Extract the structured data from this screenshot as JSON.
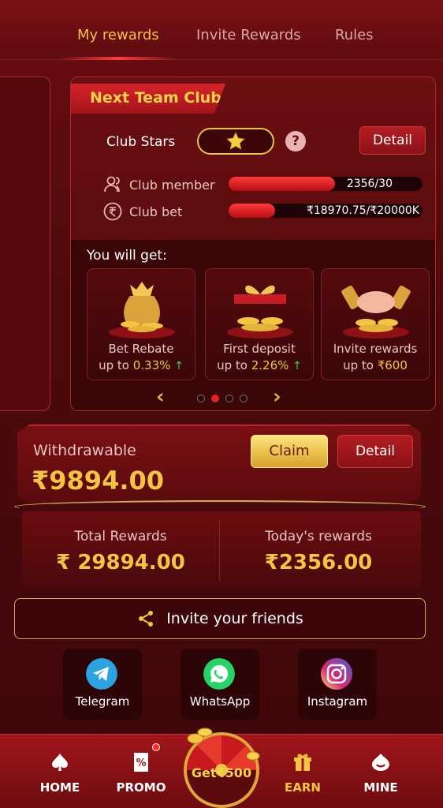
{
  "tabs": [
    {
      "label": "My rewards",
      "active": true
    },
    {
      "label": "Invite Rewards",
      "active": false
    },
    {
      "label": "Rules",
      "active": false
    }
  ],
  "club": {
    "title": "Next Team Club",
    "stars_label": "Club Stars",
    "help": "?",
    "detail_label": "Detail",
    "member": {
      "label": "Club member",
      "value": "2356/30",
      "progress": 0.55
    },
    "bet": {
      "label": "Club bet",
      "value": "₹18970.75/₹20000K",
      "progress": 0.24
    }
  },
  "rewards": {
    "heading": "You will get:",
    "items": [
      {
        "title": "Bet Rebate",
        "prefix": "up to ",
        "value": "0.33%",
        "arrow": "↑"
      },
      {
        "title": "First deposit",
        "prefix": "up to ",
        "value": "2.26%",
        "arrow": "↑"
      },
      {
        "title": "Invite rewards",
        "prefix": "up to ",
        "value": "₹600",
        "arrow": ""
      }
    ],
    "page": 2,
    "pages": 4
  },
  "withdraw": {
    "label": "Withdrawable",
    "value": "₹9894.00",
    "claim_label": "Claim",
    "detail_label": "Detail"
  },
  "totals": {
    "total_label": "Total Rewards",
    "total_value": "₹ 29894.00",
    "today_label": "Today's rewards",
    "today_value": "₹2356.00"
  },
  "invite": {
    "label": "Invite your friends"
  },
  "social": [
    {
      "label": "Telegram",
      "icon": "telegram-icon",
      "color": "#2aa3e0"
    },
    {
      "label": "WhatsApp",
      "icon": "whatsapp-icon",
      "color": "#25d366"
    },
    {
      "label": "Instagram",
      "icon": "instagram-icon",
      "color": "#d62976"
    }
  ],
  "nav": {
    "home": "HOME",
    "promo": "PROMO",
    "center": "Get₹500",
    "earn": "EARN",
    "mine": "MINE",
    "active": "EARN"
  },
  "colors": {
    "gold": "#f4c542",
    "accent_red": "#e0202a",
    "green": "#3ccf4e"
  }
}
